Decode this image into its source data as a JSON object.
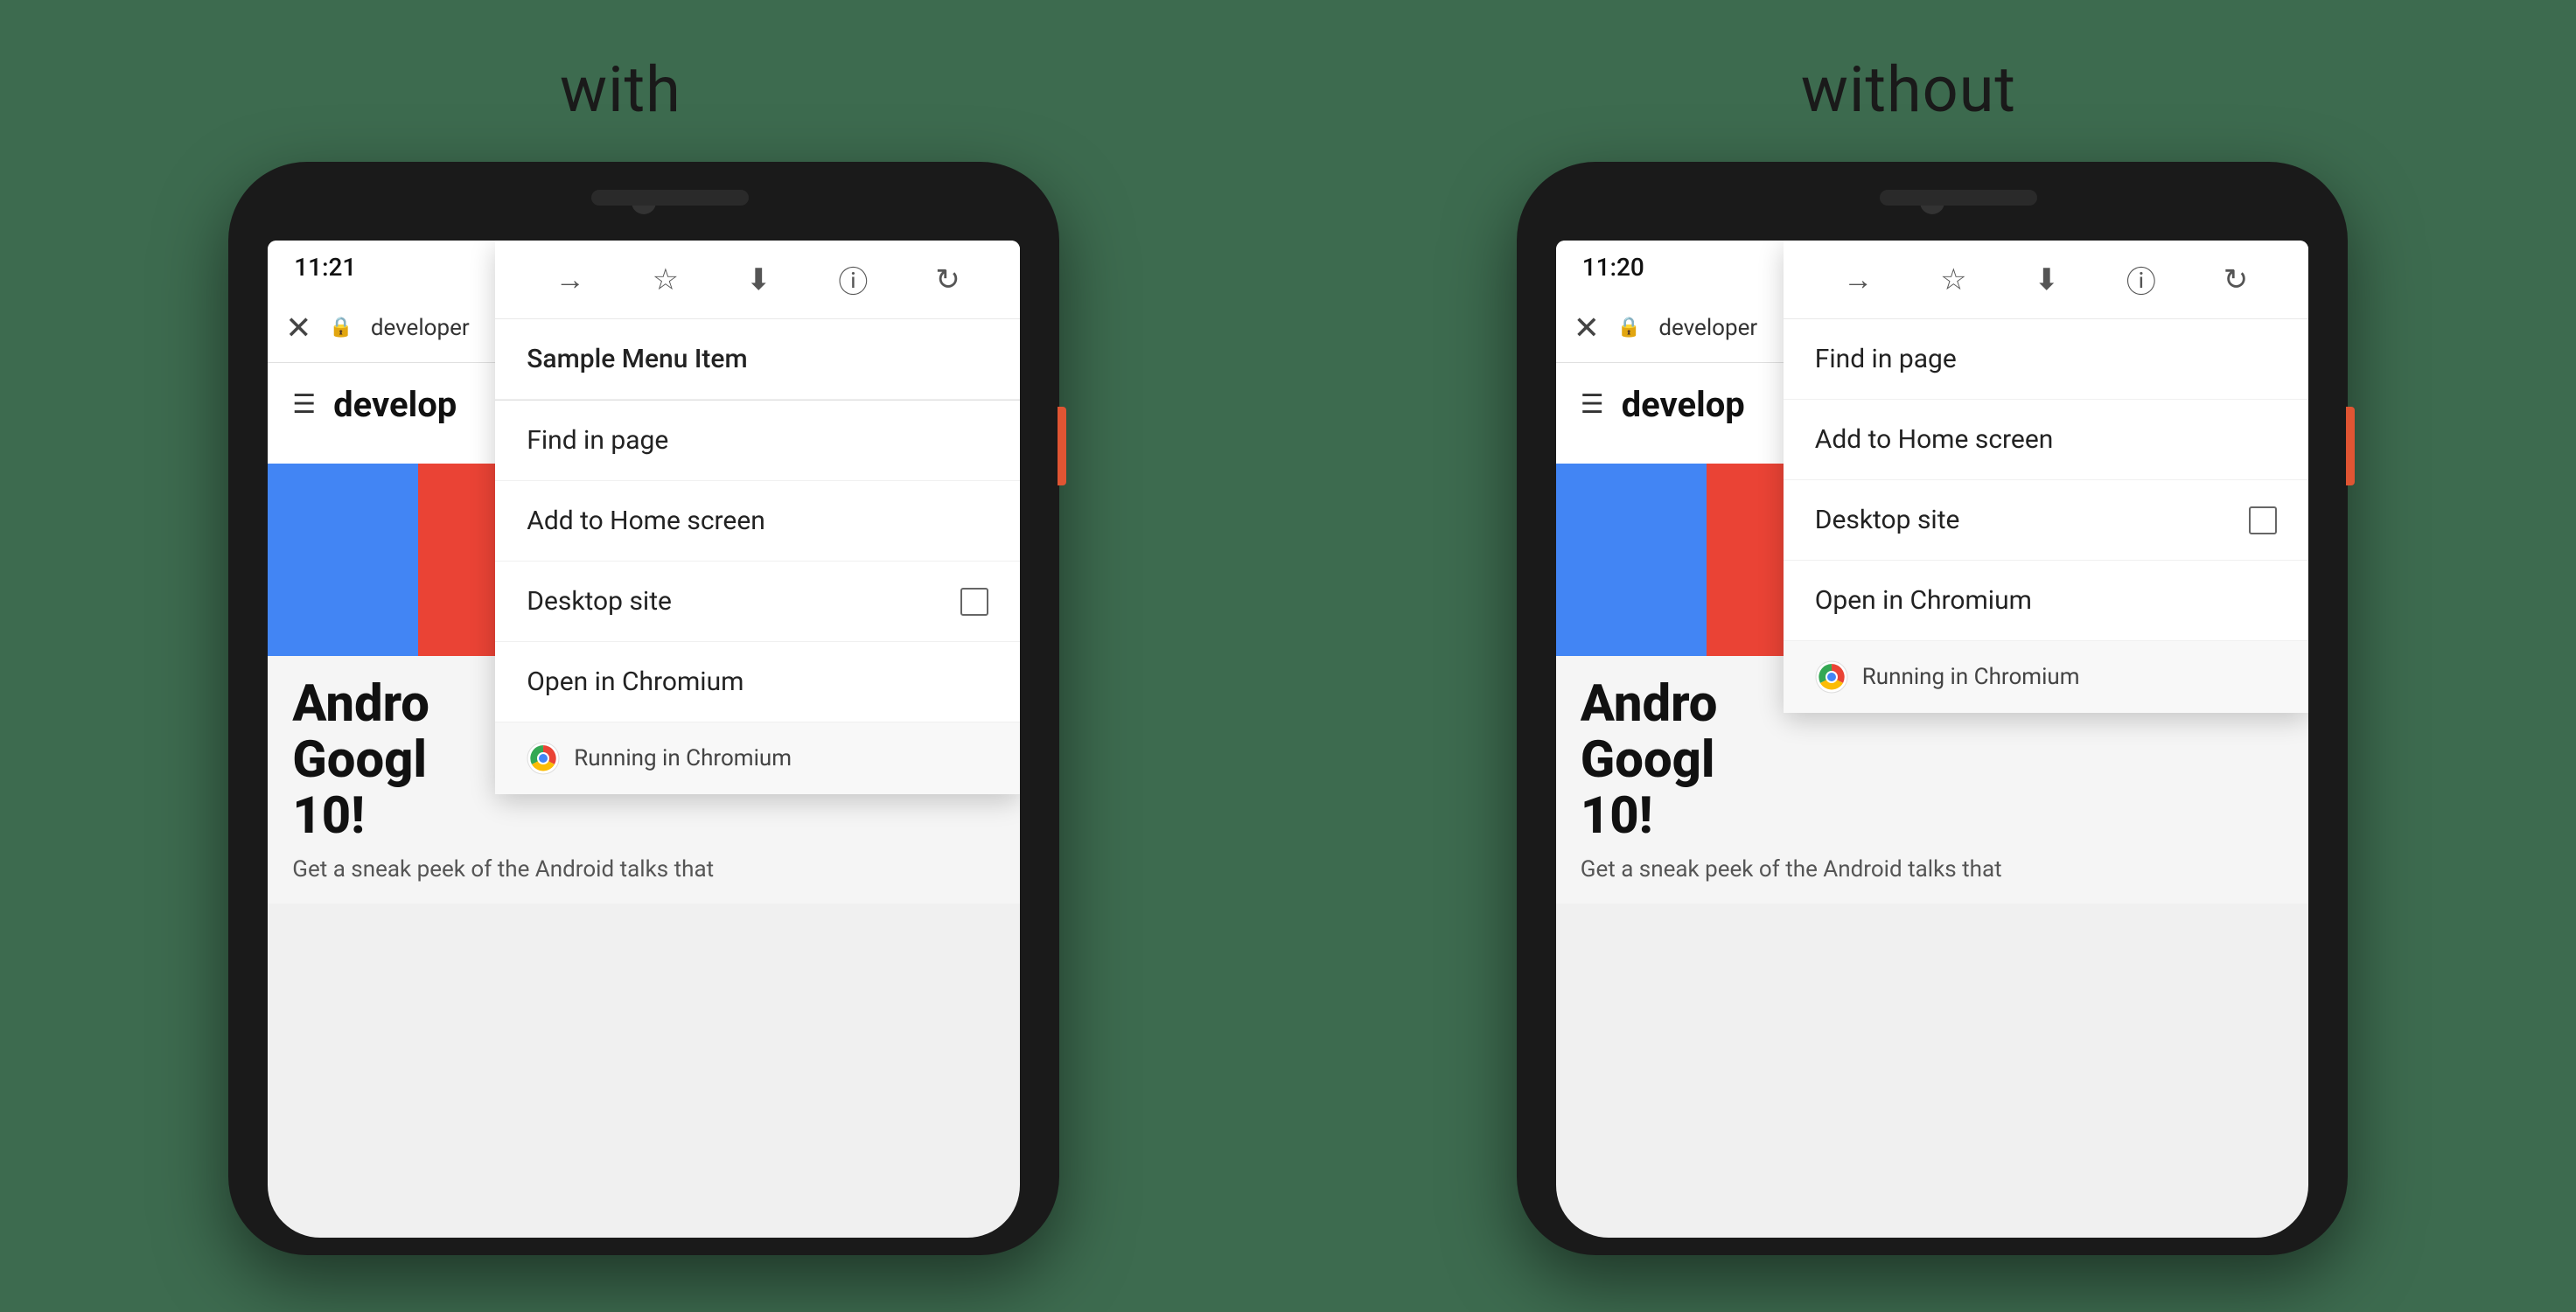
{
  "background_color": "#3d6b4f",
  "labels": {
    "with": "with",
    "without": "without"
  },
  "phone_left": {
    "time": "11:21",
    "url_text": "developer",
    "web_logo": "develop",
    "dropdown": {
      "menu_items": [
        {
          "label": "Sample Menu Item",
          "has_checkbox": false,
          "is_separator_after": true
        },
        {
          "label": "Find in page",
          "has_checkbox": false
        },
        {
          "label": "Add to Home screen",
          "has_checkbox": false
        },
        {
          "label": "Desktop site",
          "has_checkbox": true
        },
        {
          "label": "Open in Chromium",
          "has_checkbox": false
        }
      ],
      "footer_text": "Running in Chromium"
    }
  },
  "phone_right": {
    "time": "11:20",
    "url_text": "developer",
    "web_logo": "develop",
    "dropdown": {
      "menu_items": [
        {
          "label": "Find in page",
          "has_checkbox": false
        },
        {
          "label": "Add to Home screen",
          "has_checkbox": false
        },
        {
          "label": "Desktop site",
          "has_checkbox": true
        },
        {
          "label": "Open in Chromium",
          "has_checkbox": false
        }
      ],
      "footer_text": "Running in Chromium"
    }
  },
  "android_content": {
    "title_line1": "Andro",
    "title_line2": "Googl",
    "title_line3": "10!",
    "subtitle": "Get a sneak peek of the Android talks that"
  },
  "icons": {
    "forward": "→",
    "bookmark": "☆",
    "download": "⬇",
    "info": "ⓘ",
    "refresh": "↻",
    "close": "✕",
    "menu": "☰"
  }
}
